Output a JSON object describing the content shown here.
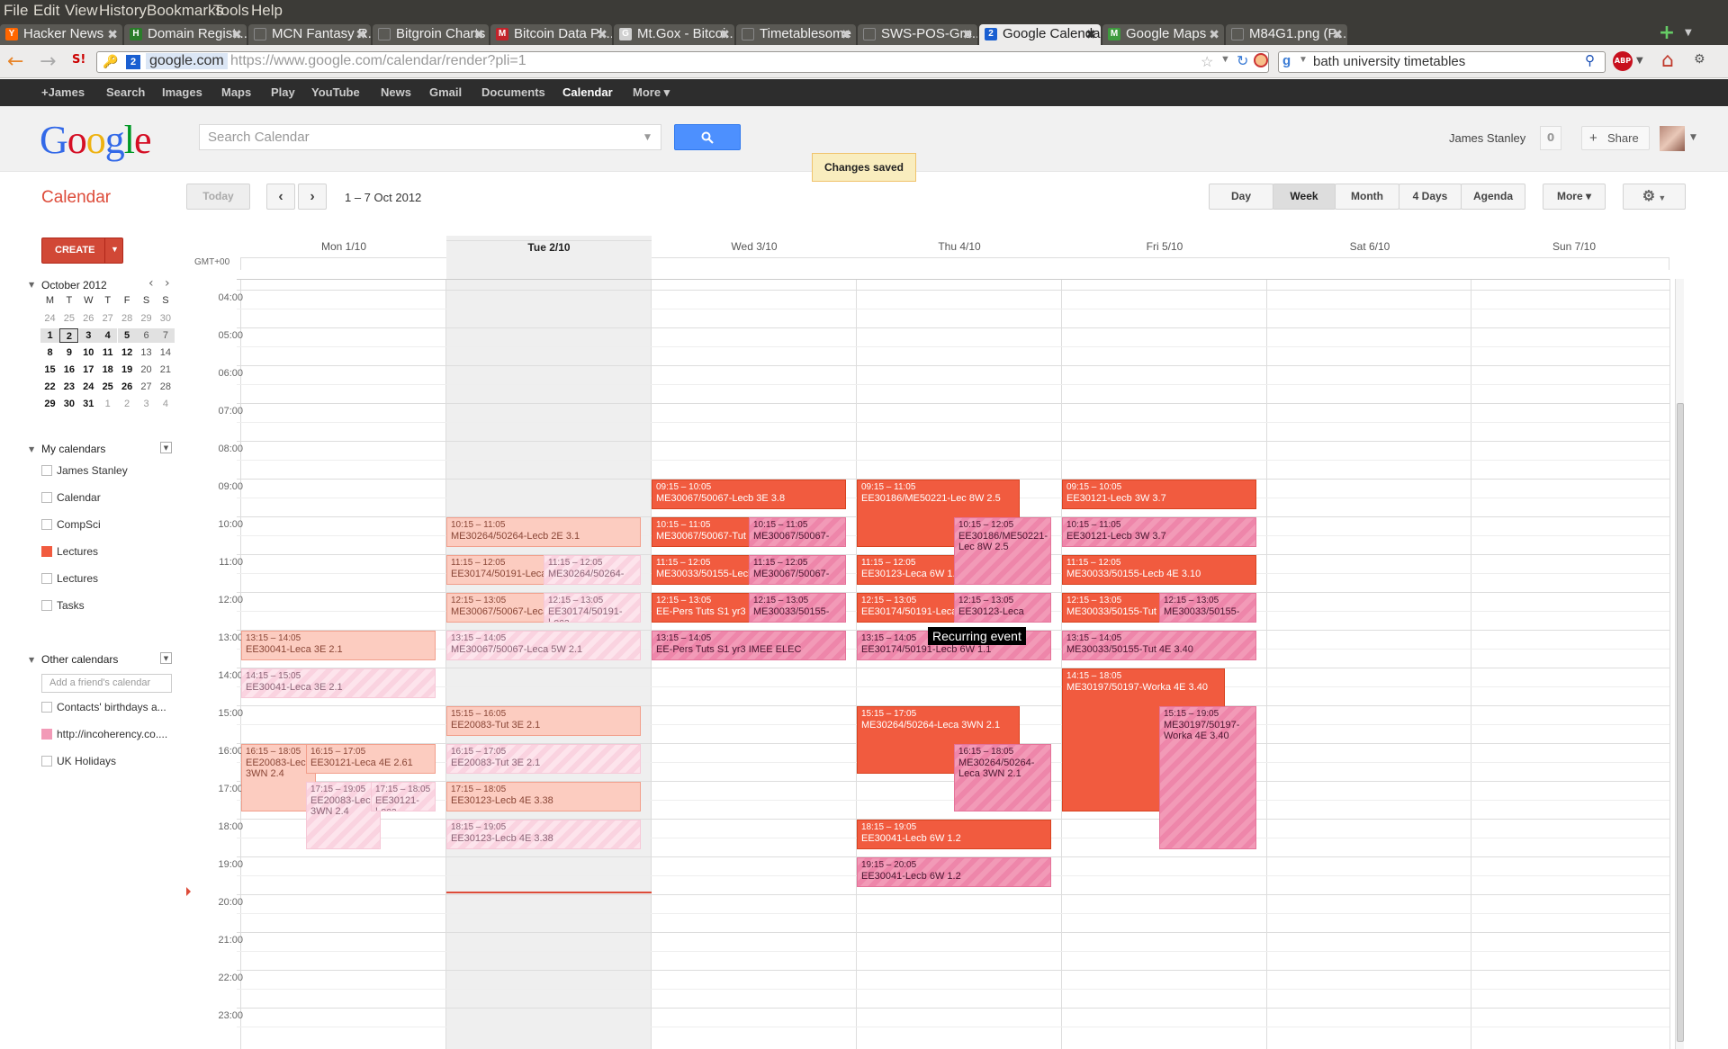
{
  "menu": [
    "File",
    "Edit",
    "View",
    "History",
    "Bookmarks",
    "Tools",
    "Help"
  ],
  "tabs": [
    {
      "label": "Hacker News",
      "fav": "Y",
      "color": "#ff6600"
    },
    {
      "label": "Domain Regist...",
      "fav": "H",
      "color": "#2a7d2a"
    },
    {
      "label": "MCN Fantasy R...",
      "fav": "",
      "color": "#5a5954"
    },
    {
      "label": "Bitgroin Charts",
      "fav": "",
      "color": "#5a5954"
    },
    {
      "label": "Bitcoin Data Pl...",
      "fav": "M",
      "color": "#c3232b"
    },
    {
      "label": "Mt.Gox - Bitcoi...",
      "fav": "G",
      "color": "#d0d0d0"
    },
    {
      "label": "Timetablesome",
      "fav": "",
      "color": "#5a5954"
    },
    {
      "label": "SWS-POS-Gro...",
      "fav": "",
      "color": "#5a5954"
    },
    {
      "label": "Google Calendar",
      "fav": "2",
      "color": "#1a5fd1"
    },
    {
      "label": "Google Maps",
      "fav": "M",
      "color": "#3e9b3e"
    },
    {
      "label": "M84G1.png (P...",
      "fav": "",
      "color": "#5a5954"
    }
  ],
  "url": {
    "domain": "google.com",
    "full": "https://www.google.com/calendar/render?pli=1"
  },
  "browser_search": "bath university timetables",
  "gbar": [
    "+James",
    "Search",
    "Images",
    "Maps",
    "Play",
    "YouTube",
    "News",
    "Gmail",
    "Documents",
    "Calendar",
    "More ▾"
  ],
  "header": {
    "search_placeholder": "Search Calendar",
    "user": "James Stanley",
    "notif_count": "0",
    "share": "Share",
    "toast": "Changes saved"
  },
  "toolbar": {
    "app_title": "Calendar",
    "today": "Today",
    "date_range": "1 – 7 Oct 2012",
    "views": [
      "Day",
      "Week",
      "Month",
      "4 Days",
      "Agenda"
    ],
    "more": "More ▾",
    "create": "CREATE"
  },
  "minical": {
    "title": "October 2012",
    "dow": [
      "M",
      "T",
      "W",
      "T",
      "F",
      "S",
      "S"
    ],
    "weeks": [
      [
        "24",
        "25",
        "26",
        "27",
        "28",
        "29",
        "30"
      ],
      [
        "1",
        "2",
        "3",
        "4",
        "5",
        "6",
        "7"
      ],
      [
        "8",
        "9",
        "10",
        "11",
        "12",
        "13",
        "14"
      ],
      [
        "15",
        "16",
        "17",
        "18",
        "19",
        "20",
        "21"
      ],
      [
        "22",
        "23",
        "24",
        "25",
        "26",
        "27",
        "28"
      ],
      [
        "29",
        "30",
        "31",
        "1",
        "2",
        "3",
        "4"
      ]
    ]
  },
  "my_calendars": {
    "title": "My calendars",
    "items": [
      {
        "label": "James Stanley",
        "color": ""
      },
      {
        "label": "Calendar",
        "color": ""
      },
      {
        "label": "CompSci",
        "color": ""
      },
      {
        "label": "Lectures",
        "color": "#f15b3f"
      },
      {
        "label": "Lectures",
        "color": ""
      },
      {
        "label": "Tasks",
        "color": ""
      }
    ]
  },
  "other_calendars": {
    "title": "Other calendars",
    "add_placeholder": "Add a friend's calendar",
    "items": [
      {
        "label": "Contacts' birthdays a...",
        "color": ""
      },
      {
        "label": "http://incoherency.co....",
        "color": "#f29ab7"
      },
      {
        "label": "UK Holidays",
        "color": ""
      }
    ]
  },
  "grid": {
    "timezone": "GMT+00",
    "days": [
      "Mon 1/10",
      "Tue 2/10",
      "Wed 3/10",
      "Thu 4/10",
      "Fri 5/10",
      "Sat 6/10",
      "Sun 7/10"
    ],
    "hours": [
      "04:00",
      "05:00",
      "06:00",
      "07:00",
      "08:00",
      "09:00",
      "10:00",
      "11:00",
      "12:00",
      "13:00",
      "14:00",
      "15:00",
      "16:00",
      "17:00",
      "18:00",
      "19:00",
      "20:00",
      "21:00",
      "22:00",
      "23:00"
    ]
  },
  "events": [
    {
      "day": 0,
      "time": "13:15 – 14:05",
      "title": "EE30041-Leca 3E 2.1",
      "start": 13.25,
      "end": 14.08,
      "col": 0,
      "cols": 1,
      "style": "pale"
    },
    {
      "day": 0,
      "time": "14:15 – 15:05",
      "title": "EE30041-Leca 3E 2.1",
      "start": 14.25,
      "end": 15.08,
      "col": 0,
      "cols": 1,
      "style": "palepink"
    },
    {
      "day": 0,
      "time": "16:15 – 18:05",
      "title": "EE20083-Leca 3WN 2.4",
      "start": 16.25,
      "end": 18.08,
      "col": 0,
      "cols": 3,
      "style": "pale"
    },
    {
      "day": 0,
      "time": "16:15 – 17:05",
      "title": "EE30121-Leca 4E 2.61",
      "start": 16.25,
      "end": 17.08,
      "col": 1,
      "cols": 3,
      "span": 2,
      "style": "pale"
    },
    {
      "day": 0,
      "time": "17:15 – 19:05",
      "title": "EE20083-Leca 3WN 2.4",
      "start": 17.25,
      "end": 19.08,
      "col": 1,
      "cols": 3,
      "style": "palepink"
    },
    {
      "day": 0,
      "time": "17:15 – 18:05",
      "title": "EE30121-Leca",
      "start": 17.25,
      "end": 18.08,
      "col": 2,
      "cols": 3,
      "style": "palepink"
    },
    {
      "day": 1,
      "time": "10:15 – 11:05",
      "title": "ME30264/50264-Lecb 2E 3.1",
      "start": 10.25,
      "end": 11.08,
      "col": 0,
      "cols": 1,
      "style": "pale"
    },
    {
      "day": 1,
      "time": "11:15 – 12:05",
      "title": "EE30174/50191-Leca",
      "start": 11.25,
      "end": 12.08,
      "col": 0,
      "cols": 2,
      "style": "pale"
    },
    {
      "day": 1,
      "time": "11:15 – 12:05",
      "title": "ME30264/50264-",
      "start": 11.25,
      "end": 12.08,
      "col": 1,
      "cols": 2,
      "style": "palepink"
    },
    {
      "day": 1,
      "time": "12:15 – 13:05",
      "title": "ME30067/50067-Leca",
      "start": 12.25,
      "end": 13.08,
      "col": 0,
      "cols": 2,
      "style": "pale"
    },
    {
      "day": 1,
      "time": "12:15 – 13:05",
      "title": "EE30174/50191-Leca",
      "start": 12.25,
      "end": 13.08,
      "col": 1,
      "cols": 2,
      "style": "palepink"
    },
    {
      "day": 1,
      "time": "13:15 – 14:05",
      "title": "ME30067/50067-Leca 5W 2.1",
      "start": 13.25,
      "end": 14.08,
      "col": 0,
      "cols": 1,
      "style": "palepink"
    },
    {
      "day": 1,
      "time": "15:15 – 16:05",
      "title": "EE20083-Tut 3E 2.1",
      "start": 15.25,
      "end": 16.08,
      "col": 0,
      "cols": 1,
      "style": "pale"
    },
    {
      "day": 1,
      "time": "16:15 – 17:05",
      "title": "EE20083-Tut 3E 2.1",
      "start": 16.25,
      "end": 17.08,
      "col": 0,
      "cols": 1,
      "style": "palepink"
    },
    {
      "day": 1,
      "time": "17:15 – 18:05",
      "title": "EE30123-Lecb 4E 3.38",
      "start": 17.25,
      "end": 18.08,
      "col": 0,
      "cols": 1,
      "style": "pale"
    },
    {
      "day": 1,
      "time": "18:15 – 19:05",
      "title": "EE30123-Lecb 4E 3.38",
      "start": 18.25,
      "end": 19.08,
      "col": 0,
      "cols": 1,
      "style": "palepink"
    },
    {
      "day": 2,
      "time": "09:15 – 10:05",
      "title": "ME30067/50067-Lecb 3E 3.8",
      "start": 9.25,
      "end": 10.08,
      "col": 0,
      "cols": 1,
      "style": "red"
    },
    {
      "day": 2,
      "time": "10:15 – 11:05",
      "title": "ME30067/50067-Tut",
      "start": 10.25,
      "end": 11.08,
      "col": 0,
      "cols": 2,
      "style": "red"
    },
    {
      "day": 2,
      "time": "10:15 – 11:05",
      "title": "ME30067/50067-",
      "start": 10.25,
      "end": 11.08,
      "col": 1,
      "cols": 2,
      "style": "pink"
    },
    {
      "day": 2,
      "time": "11:15 – 12:05",
      "title": "ME30033/50155-Lecb",
      "start": 11.25,
      "end": 12.08,
      "col": 0,
      "cols": 2,
      "style": "red"
    },
    {
      "day": 2,
      "time": "11:15 – 12:05",
      "title": "ME30067/50067-",
      "start": 11.25,
      "end": 12.08,
      "col": 1,
      "cols": 2,
      "style": "pink"
    },
    {
      "day": 2,
      "time": "12:15 – 13:05",
      "title": "EE-Pers Tuts S1 yr3",
      "start": 12.25,
      "end": 13.08,
      "col": 0,
      "cols": 2,
      "style": "red"
    },
    {
      "day": 2,
      "time": "12:15 – 13:05",
      "title": "ME30033/50155-",
      "start": 12.25,
      "end": 13.08,
      "col": 1,
      "cols": 2,
      "style": "pink"
    },
    {
      "day": 2,
      "time": "13:15 – 14:05",
      "title": "EE-Pers Tuts S1 yr3 IMEE ELEC",
      "start": 13.25,
      "end": 14.08,
      "col": 0,
      "cols": 1,
      "style": "pink"
    },
    {
      "day": 3,
      "time": "09:15 – 11:05",
      "title": "EE30186/ME50221-Lec 8W 2.5",
      "start": 9.25,
      "end": 11.08,
      "col": 0,
      "cols": 1,
      "w": 0.84,
      "style": "red"
    },
    {
      "day": 3,
      "time": "10:15 – 12:05",
      "title": "EE30186/ME50221-Lec 8W 2.5",
      "start": 10.25,
      "end": 12.08,
      "col": 1,
      "cols": 2,
      "style": "pink"
    },
    {
      "day": 3,
      "time": "11:15 – 12:05",
      "title": "EE30123-Leca 6W 1.1",
      "start": 11.25,
      "end": 12.08,
      "col": 0,
      "cols": 2,
      "style": "red"
    },
    {
      "day": 3,
      "time": "12:15 – 13:05",
      "title": "EE30174/50191-Leca",
      "start": 12.25,
      "end": 13.08,
      "col": 0,
      "cols": 2,
      "style": "red"
    },
    {
      "day": 3,
      "time": "12:15 – 13:05",
      "title": "EE30123-Leca",
      "start": 12.25,
      "end": 13.08,
      "col": 1,
      "cols": 2,
      "style": "pink"
    },
    {
      "day": 3,
      "time": "13:15 – 14:05",
      "title": "EE30174/50191-Lecb 6W 1.1",
      "start": 13.25,
      "end": 14.08,
      "col": 0,
      "cols": 1,
      "style": "pink"
    },
    {
      "day": 3,
      "time": "15:15 – 17:05",
      "title": "ME30264/50264-Leca 3WN 2.1",
      "start": 15.25,
      "end": 17.08,
      "col": 0,
      "cols": 1,
      "w": 0.84,
      "style": "red"
    },
    {
      "day": 3,
      "time": "16:15 – 18:05",
      "title": "ME30264/50264-Leca 3WN 2.1",
      "start": 16.25,
      "end": 18.08,
      "col": 1,
      "cols": 2,
      "style": "pink"
    },
    {
      "day": 3,
      "time": "18:15 – 19:05",
      "title": "EE30041-Lecb 6W 1.2",
      "start": 18.25,
      "end": 19.08,
      "col": 0,
      "cols": 1,
      "style": "red"
    },
    {
      "day": 3,
      "time": "19:15 – 20:05",
      "title": "EE30041-Lecb 6W 1.2",
      "start": 19.25,
      "end": 20.08,
      "col": 0,
      "cols": 1,
      "style": "pink"
    },
    {
      "day": 4,
      "time": "09:15 – 10:05",
      "title": "EE30121-Lecb 3W 3.7",
      "start": 9.25,
      "end": 10.08,
      "col": 0,
      "cols": 1,
      "style": "red"
    },
    {
      "day": 4,
      "time": "10:15 – 11:05",
      "title": "EE30121-Lecb 3W 3.7",
      "start": 10.25,
      "end": 11.08,
      "col": 0,
      "cols": 1,
      "style": "pink"
    },
    {
      "day": 4,
      "time": "11:15 – 12:05",
      "title": "ME30033/50155-Lecb 4E 3.10",
      "start": 11.25,
      "end": 12.08,
      "col": 0,
      "cols": 1,
      "style": "red"
    },
    {
      "day": 4,
      "time": "12:15 – 13:05",
      "title": "ME30033/50155-Tut",
      "start": 12.25,
      "end": 13.08,
      "col": 0,
      "cols": 2,
      "style": "red"
    },
    {
      "day": 4,
      "time": "12:15 – 13:05",
      "title": "ME30033/50155-",
      "start": 12.25,
      "end": 13.08,
      "col": 1,
      "cols": 2,
      "style": "pink"
    },
    {
      "day": 4,
      "time": "13:15 – 14:05",
      "title": "ME30033/50155-Tut 4E 3.40",
      "start": 13.25,
      "end": 14.08,
      "col": 0,
      "cols": 1,
      "style": "pink"
    },
    {
      "day": 4,
      "time": "14:15 – 18:05",
      "title": "ME30197/50197-Worka 4E 3.40",
      "start": 14.25,
      "end": 18.08,
      "col": 0,
      "cols": 1,
      "w": 0.84,
      "style": "red"
    },
    {
      "day": 4,
      "time": "15:15 – 19:05",
      "title": "ME30197/50197-Worka 4E 3.40",
      "start": 15.25,
      "end": 19.08,
      "col": 1,
      "cols": 2,
      "style": "pink"
    }
  ],
  "tooltip": "Recurring event"
}
